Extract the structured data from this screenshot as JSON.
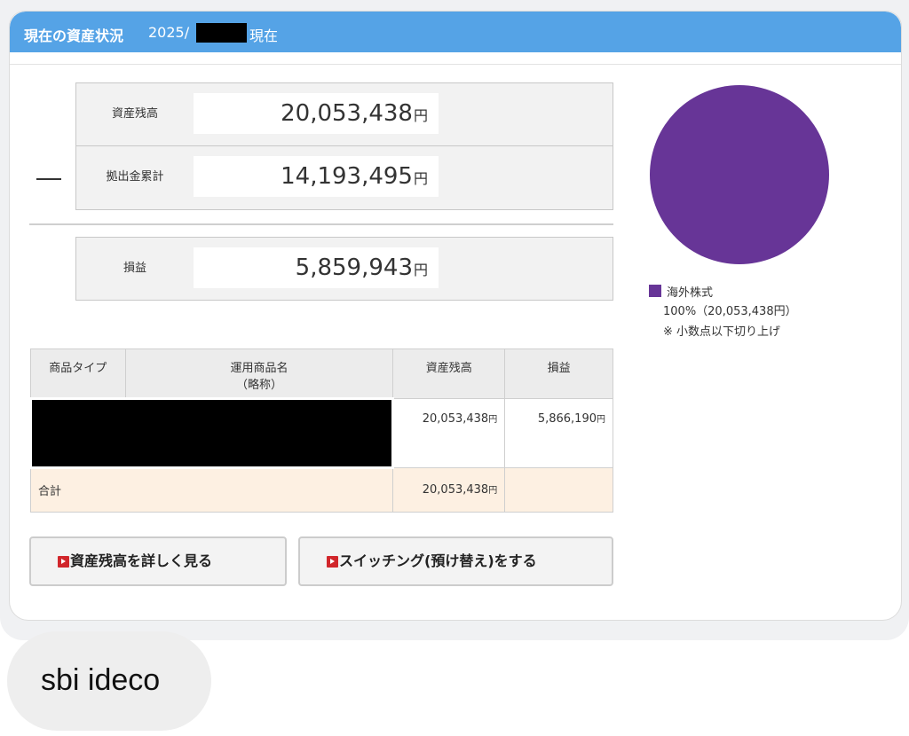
{
  "header": {
    "title": "現在の資産状況",
    "date_prefix": "2025/",
    "date_suffix": "現在"
  },
  "summary": {
    "balance_label": "資産残高",
    "balance_value": "20,053,438",
    "contribution_label": "拠出金累計",
    "contribution_value": "14,193,495",
    "profit_label": "損益",
    "profit_value": "5,859,943",
    "yen": "円"
  },
  "table": {
    "headers": {
      "type": "商品タイプ",
      "name_line1": "運用商品名",
      "name_line2": "（略称）",
      "balance": "資産残高",
      "profit": "損益"
    },
    "row": {
      "balance": "20,053,438",
      "profit": "5,866,190"
    },
    "total": {
      "label": "合計",
      "balance": "20,053,438"
    },
    "yen": "円"
  },
  "buttons": {
    "detail": "資産残高を詳しく見る",
    "switching": "スイッチング(預け替え)をする"
  },
  "chart_data": {
    "type": "pie",
    "slices": [
      {
        "label": "海外株式",
        "percent": 100,
        "amount": "20,053,438円",
        "color": "#673597"
      }
    ],
    "legend_pct": "100%（20,053,438円）",
    "note": "※ 小数点以下切り上げ"
  },
  "chat": {
    "message": "sbi ideco"
  }
}
